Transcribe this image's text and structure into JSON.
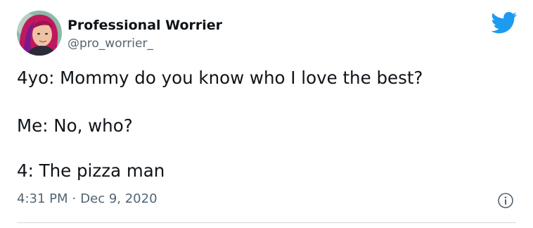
{
  "author": {
    "display_name": "Professional Worrier",
    "handle": "@pro_worrier_"
  },
  "tweet": {
    "lines": [
      "4yo: Mommy do you know who I love the best?",
      "Me: No, who?",
      "4: The pizza man"
    ],
    "time": "4:31 PM",
    "separator": "·",
    "date": "Dec 9, 2020"
  },
  "icons": {
    "logo": "twitter-bird-icon",
    "info": "info-icon"
  },
  "colors": {
    "brand": "#1d9bf0",
    "text": "#0f1419",
    "secondary": "#536471",
    "divider": "#cfd9de"
  }
}
